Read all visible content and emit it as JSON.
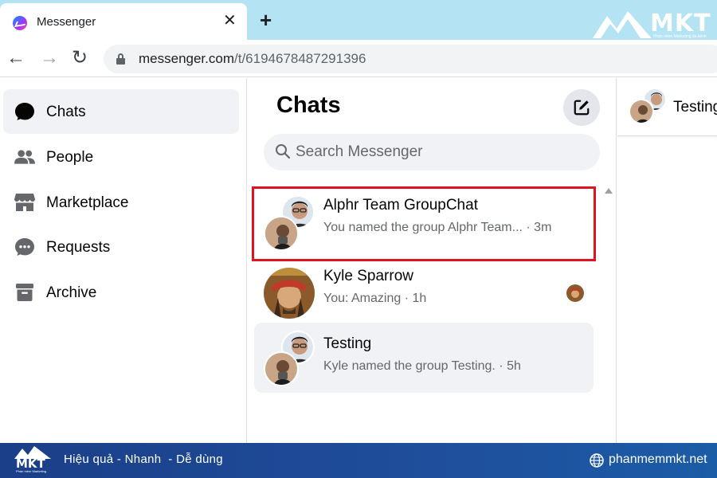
{
  "browser": {
    "tab_title": "Messenger",
    "close_glyph": "✕",
    "newtab_glyph": "+",
    "url_host": "messenger.com",
    "url_path": "/t/6194678487291396",
    "back_glyph": "←",
    "forward_glyph": "→",
    "reload_glyph": "↻"
  },
  "watermark": {
    "brand": "MKT",
    "tagline": "Phần mềm Marketing đa kênh"
  },
  "leftnav": {
    "items": [
      {
        "label": "Chats",
        "icon": "chat-bubble-icon",
        "active": true
      },
      {
        "label": "People",
        "icon": "people-icon",
        "active": false
      },
      {
        "label": "Marketplace",
        "icon": "marketplace-store-icon",
        "active": false
      },
      {
        "label": "Requests",
        "icon": "requests-bubble-icon",
        "active": false
      },
      {
        "label": "Archive",
        "icon": "archive-box-icon",
        "active": false
      }
    ]
  },
  "chats": {
    "title": "Chats",
    "search_placeholder": "Search Messenger",
    "conversations": [
      {
        "name": "Alphr Team GroupChat",
        "snippet": "You named the group Alphr Team... · 3m",
        "highlighted": true,
        "group": true
      },
      {
        "name": "Kyle Sparrow",
        "snippet": "You: Amazing · 1h",
        "highlighted": false,
        "group": false
      },
      {
        "name": "Testing",
        "snippet": "Kyle named the group Testing. · 5h",
        "highlighted": false,
        "group": true,
        "selected": true
      }
    ]
  },
  "conversation_header": {
    "name": "Testing"
  },
  "banner": {
    "slogan": "Hiệu quả - Nhanh  - Dễ dùng",
    "site": "phanmemmkt.net",
    "brand": "MKT",
    "tagline": "Phần mềm Marketing"
  },
  "colors": {
    "tabbar": "#b4e3f3",
    "highlight_box": "#e0141e",
    "secondary_text": "#65676b",
    "banner": "#1b3f88"
  }
}
